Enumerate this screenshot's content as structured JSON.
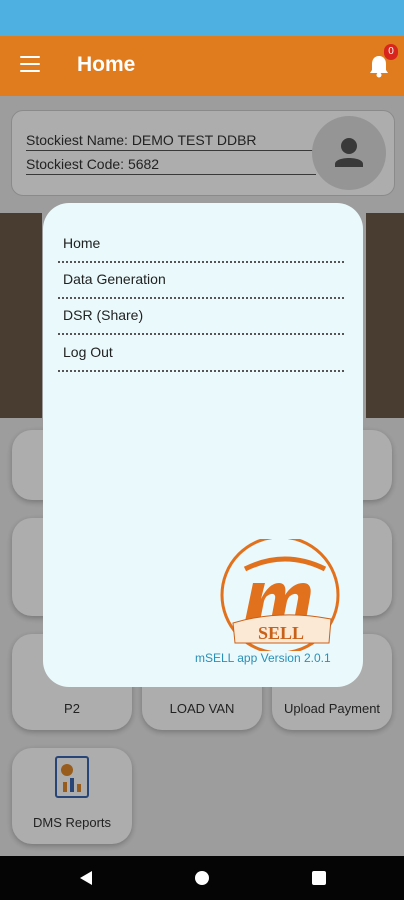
{
  "app_bar": {
    "title": "Home",
    "notification_count": "0"
  },
  "stockist": {
    "name": "Stockiest Name: DEMO TEST DDBR",
    "code": "Stockiest Code: 5682"
  },
  "tiles": {
    "p2": "P2",
    "load_van": "LOAD VAN",
    "upload_payment": "Upload Payment",
    "dms_reports": "DMS Reports"
  },
  "side_menu": {
    "items": [
      {
        "label": "Home"
      },
      {
        "label": "Data Generation"
      },
      {
        "label": "DSR (Share)"
      },
      {
        "label": "Log Out"
      }
    ],
    "version": "mSELL app Version 2.0.1"
  },
  "colors": {
    "app_bar": "#e07b1e",
    "status_bar": "#4db0e0",
    "dialog_bg": "#eaf9fb",
    "version_text": "#2a8fb8"
  }
}
